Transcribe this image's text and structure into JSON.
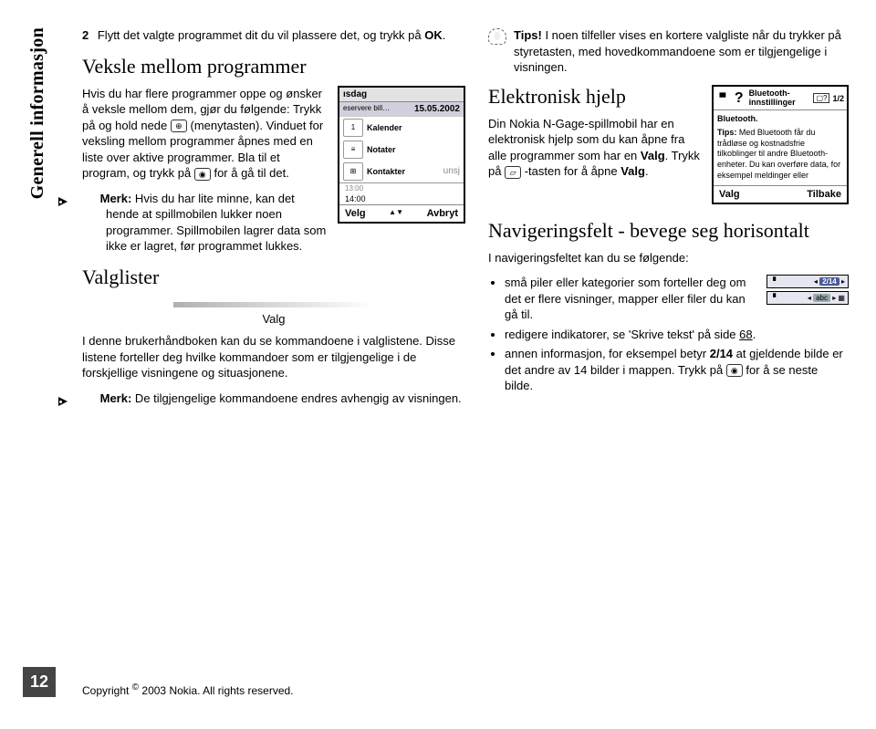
{
  "sidebar": "Generell informasjon",
  "page_number": "12",
  "left": {
    "step_num": "2",
    "step_text_a": "Flytt det valgte programmet dit du vil plassere det, og trykk på ",
    "step_text_b": "OK",
    "step_text_c": ".",
    "h_veksle": "Veksle mellom programmer",
    "para1_a": "Hvis du har flere programmer oppe og ønsker å veksle mellom dem, gjør du følgende: Trykk på og hold nede ",
    "para1_b": " (menytasten). Vinduet for veksling mellom programmer åpnes med en liste over aktive programmer. Bla til et program, og trykk på ",
    "para1_c": " for å gå til det.",
    "merk1_label": "Merk:",
    "merk1_text": " Hvis du har lite minne, kan det hende at spillmobilen lukker noen programmer. Spillmobilen lagrer data som ikke er lagret, før programmet lukkes.",
    "h_valg": "Valglister",
    "valg_label": "Valg",
    "para2": "I denne brukerhåndboken kan du se kommandoene i valglistene. Disse listene forteller deg hvilke kommandoer som er tilgjengelige i de forskjellige visningene og situasjonene.",
    "merk2_label": "Merk:",
    "merk2_text": " De tilgjengelige kommandoene endres avhengig av visningen.",
    "screenshot": {
      "dag": "ısdag",
      "dato": "15.05.2002",
      "kalender": "Kalender",
      "reservere": "eservere bill…",
      "notater": "Notater",
      "kontakter": "Kontakter",
      "unsj": "unsj",
      "tid1": "13:00",
      "tid2": "14:00",
      "velg": "Velg",
      "avbryt": "Avbryt",
      "cal_num": "1"
    }
  },
  "right": {
    "tips_label": "Tips!",
    "tips_text": " I noen tilfeller vises en kortere valgliste når du trykker på styretasten, med hovedkommandoene som er tilgjengelige i visningen.",
    "h_hjelp": "Elektronisk hjelp",
    "para_hjelp_a": "Din Nokia N-Gage-spillmobil har en elektronisk hjelp som du kan åpne fra alle programmer som har en ",
    "para_hjelp_b": "Valg",
    "para_hjelp_c": ". Trykk på ",
    "para_hjelp_d": " -tasten for å åpne ",
    "para_hjelp_e": "Valg",
    "para_hjelp_f": ".",
    "bt": {
      "title": "Bluetooth-innstillinger",
      "page": "1/2",
      "sub": "Bluetooth.",
      "tips_label": "Tips:",
      "tips_body": " Med Bluetooth får du trådløse og kostnadsfrie tilkoblinger til andre Bluetooth-enheter. Du kan overføre data, for eksempel meldinger eller",
      "valg": "Valg",
      "tilbake": "Tilbake",
      "q": "?",
      "folder": "▢?"
    },
    "h_nav": "Navigeringsfelt - bevege seg horisontalt",
    "nav_intro": "I navigeringsfeltet kan du se følgende:",
    "bullets": {
      "b1": "små piler eller kategorier som forteller deg om det er flere visninger, mapper eller filer du kan gå til.",
      "b2_a": "redigere indikatorer, se 'Skrive tekst' på side ",
      "b2_b": "68",
      "b2_c": ".",
      "b3_a": "annen informasjon, for eksempel betyr ",
      "b3_b": "2/14",
      "b3_c": " at gjeldende bilde er det andre av 14 bilder i mappen. Trykk på ",
      "b3_d": " for å se neste bilde."
    },
    "badge": {
      "count": "2/14",
      "abc": "abc"
    }
  },
  "footer": {
    "text_a": "Copyright ",
    "text_b": "©",
    "text_c": " 2003 Nokia. All rights reserved."
  }
}
